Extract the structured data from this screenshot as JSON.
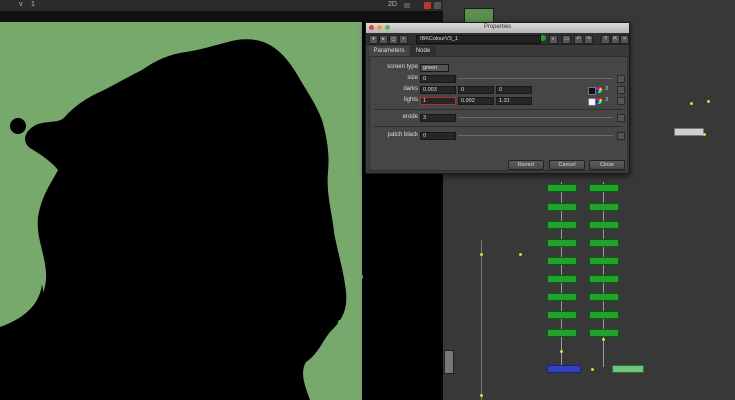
{
  "viewer": {
    "input": "v",
    "frame": "1",
    "view_mode": "2D"
  },
  "properties": {
    "window_title": "Properties",
    "node_name": "IBKColourV3_1",
    "tabs": [
      "Parameters",
      "Node"
    ],
    "screen_type": {
      "label": "screen type",
      "value": "green"
    },
    "size": {
      "label": "size",
      "value": "0"
    },
    "darks": {
      "label": "darks",
      "r": "0.003",
      "g": "0",
      "b": "0",
      "count": "3"
    },
    "lights": {
      "label": "lights",
      "r": "1",
      "g": "0.992",
      "b": "1.31",
      "count": "3"
    },
    "erode": {
      "label": "erode",
      "value": "3"
    },
    "patch_black": {
      "label": "patch black",
      "value": "0"
    },
    "buttons": {
      "revert": "Revert",
      "cancel": "Cancel",
      "close": "Close"
    }
  },
  "colors": {
    "matte_green": "#77a96c",
    "node_green": "#22a12b",
    "node_blue": "#3340c8",
    "node_lightgreen": "#6ec47a",
    "dot_yellow": "#e6d23c",
    "lights_border": "#a83232"
  }
}
